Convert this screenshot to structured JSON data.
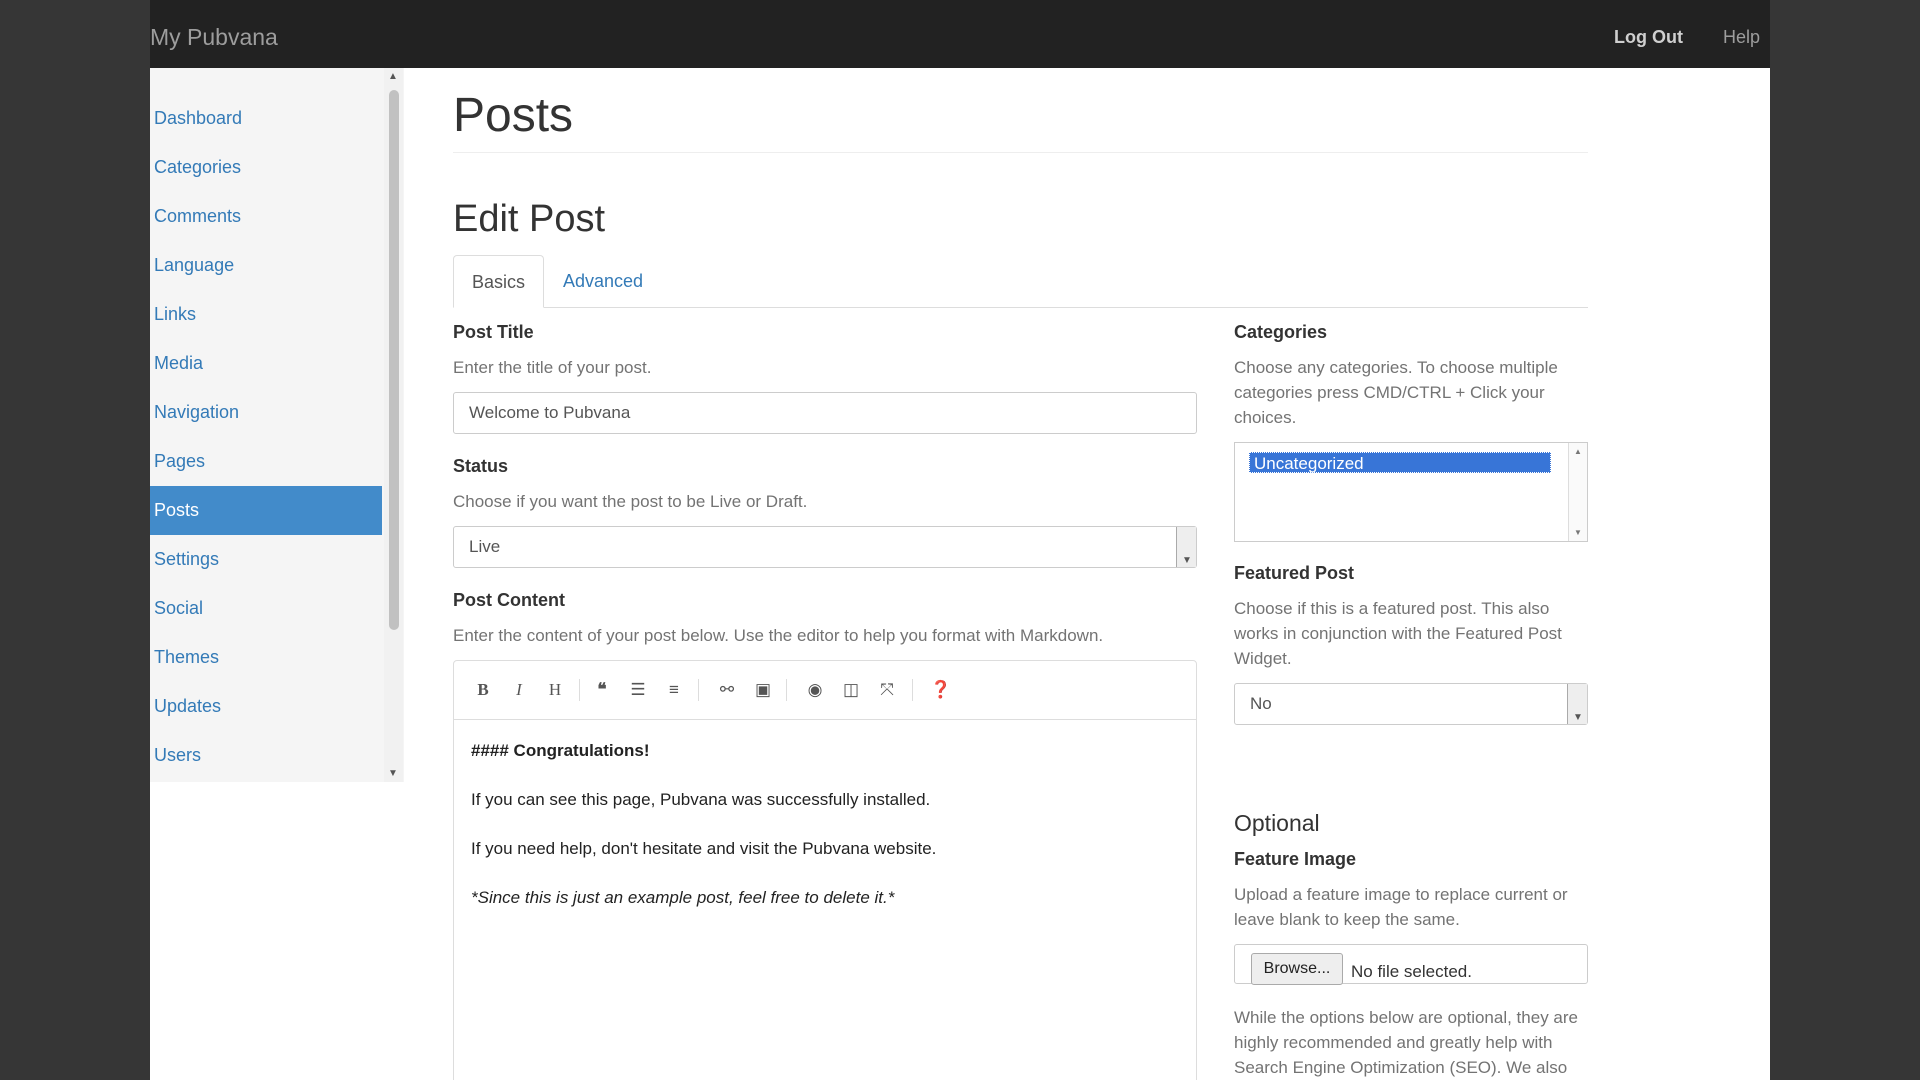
{
  "brand": "My Pubvana",
  "top_nav": {
    "logout": "Log Out",
    "help": "Help"
  },
  "sidebar": {
    "items": [
      {
        "label": "Dashboard"
      },
      {
        "label": "Categories"
      },
      {
        "label": "Comments"
      },
      {
        "label": "Language"
      },
      {
        "label": "Links"
      },
      {
        "label": "Media"
      },
      {
        "label": "Navigation"
      },
      {
        "label": "Pages"
      },
      {
        "label": "Posts",
        "active": true
      },
      {
        "label": "Settings"
      },
      {
        "label": "Social"
      },
      {
        "label": "Themes"
      },
      {
        "label": "Updates"
      },
      {
        "label": "Users"
      }
    ]
  },
  "page": {
    "title": "Posts",
    "section_title": "Edit Post"
  },
  "tabs": {
    "basics": "Basics",
    "advanced": "Advanced"
  },
  "form": {
    "post_title": {
      "label": "Post Title",
      "help": "Enter the title of your post.",
      "value": "Welcome to Pubvana"
    },
    "status": {
      "label": "Status",
      "help": "Choose if you want the post to be Live or Draft.",
      "value": "Live"
    },
    "post_content": {
      "label": "Post Content",
      "help": "Enter the content of your post below. Use the editor to help you format with Markdown.",
      "lines": [
        "#### Congratulations!",
        "If you can see this page, Pubvana was successfully installed.",
        "If you need help, don't hesitate and visit the Pubvana website.",
        "*Since this is just an example post, feel free to delete it.*"
      ]
    }
  },
  "editor_toolbar_icons": [
    "bold-icon",
    "italic-icon",
    "heading-icon",
    "quote-icon",
    "unordered-list-icon",
    "ordered-list-icon",
    "link-icon",
    "image-icon",
    "preview-icon",
    "side-by-side-icon",
    "fullscreen-icon",
    "help-icon"
  ],
  "right": {
    "categories": {
      "label": "Categories",
      "help": "Choose any categories. To choose multiple categories press CMD/CTRL + Click your choices.",
      "options": [
        "Uncategorized"
      ]
    },
    "featured_post": {
      "label": "Featured Post",
      "help": "Choose if this is a featured post. This also works in conjunction with the Featured Post Widget.",
      "value": "No"
    },
    "optional_heading": "Optional",
    "feature_image": {
      "label": "Feature Image",
      "help": "Upload a feature image to replace current or leave blank to keep the same.",
      "browse": "Browse...",
      "no_file": "No file selected."
    },
    "seo_note": "While the options below are optional, they are highly recommended and greatly help with Search Engine Optimization (SEO). We also generate meta tags for facebook and twitter with these values."
  }
}
